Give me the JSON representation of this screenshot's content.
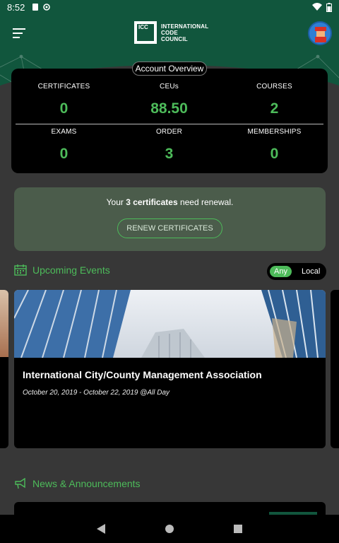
{
  "status": {
    "time": "8:52",
    "icons": [
      "sim-icon",
      "sync-icon",
      "wifi-icon",
      "battery-icon"
    ]
  },
  "header": {
    "logo_text": [
      "INTERNATIONAL",
      "CODE",
      "COUNCIL"
    ],
    "logo_mark": "ICC"
  },
  "overview": {
    "title": "Account Overview",
    "stats": [
      {
        "label": "CERTIFICATES",
        "value": "0"
      },
      {
        "label": "CEUs",
        "value": "88.50"
      },
      {
        "label": "COURSES",
        "value": "2"
      },
      {
        "label": "EXAMS",
        "value": "0"
      },
      {
        "label": "ORDER",
        "value": "3"
      },
      {
        "label": "MEMBERSHIPS",
        "value": "0"
      }
    ]
  },
  "renewal": {
    "prefix": "Your ",
    "bold": "3 certificates",
    "suffix": " need renewal.",
    "button": "RENEW CERTIFICATES"
  },
  "events": {
    "heading": "Upcoming Events",
    "toggle": [
      "Any",
      "Local"
    ],
    "active_toggle": "Any",
    "card": {
      "title": "International City/County Management Association",
      "date": "October 20, 2019 - October 22, 2019 @All Day"
    }
  },
  "news": {
    "heading": "News & Announcements"
  },
  "colors": {
    "brand": "#11563d",
    "accent": "#4dbb5a",
    "background": "#373737",
    "card": "#000000",
    "renewal_panel": "#4b5c4b"
  }
}
